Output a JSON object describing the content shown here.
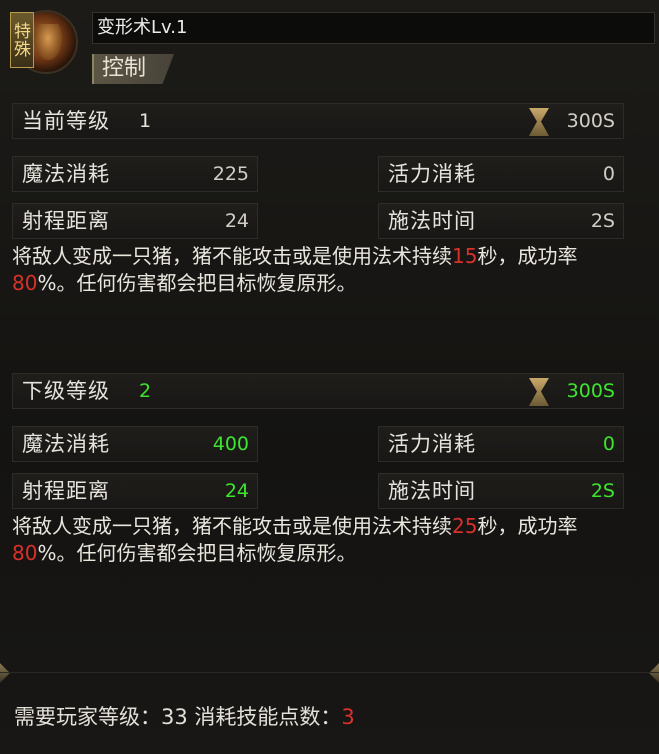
{
  "header": {
    "badge": "特殊",
    "title": "变形术Lv.1",
    "category": "控制"
  },
  "current": {
    "level_label": "当前等级",
    "level_value": "1",
    "cost_value": "300S",
    "mana_label": "魔法消耗",
    "mana_value": "225",
    "vitality_label": "活力消耗",
    "vitality_value": "0",
    "range_label": "射程距离",
    "range_value": "24",
    "cast_label": "施法时间",
    "cast_value": "2S",
    "desc_part1": "将敌人变成一只猪，猪不能攻击或是使用法术持续",
    "desc_duration": "15",
    "desc_part2": "秒，成功率",
    "desc_rate": "80",
    "desc_part3": "%。任何伤害都会把目标恢复原形。"
  },
  "next": {
    "level_label": "下级等级",
    "level_value": "2",
    "cost_value": "300S",
    "mana_label": "魔法消耗",
    "mana_value": "400",
    "vitality_label": "活力消耗",
    "vitality_value": "0",
    "range_label": "射程距离",
    "range_value": "24",
    "cast_label": "施法时间",
    "cast_value": "2S",
    "desc_part1": "将敌人变成一只猪，猪不能攻击或是使用法术持续",
    "desc_duration": "25",
    "desc_part2": "秒，成功率",
    "desc_rate": "80",
    "desc_part3": "%。任何伤害都会把目标恢复原形。"
  },
  "footer": {
    "player_level_label": "需要玩家等级：",
    "player_level_value": "33",
    "skill_points_label": "消耗技能点数：",
    "skill_points_value": "3"
  },
  "icons": {
    "avatar": "bear-portrait-icon",
    "cost": "hourglass-icon"
  },
  "colors": {
    "highlight_red": "#d8312a",
    "next_green": "#3de52e"
  }
}
